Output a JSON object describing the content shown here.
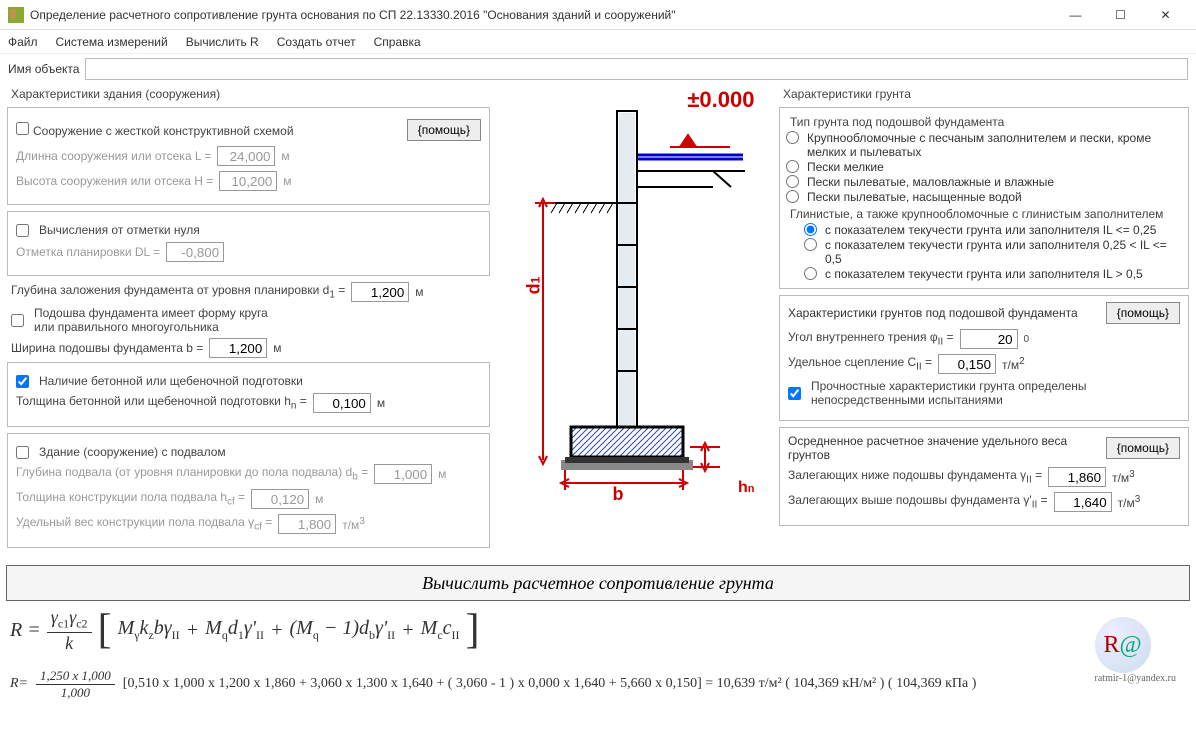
{
  "window": {
    "title": "Определение расчетного сопротивление грунта основания по СП 22.13330.2016  \"Основания зданий и сооружений\""
  },
  "menu": {
    "file": "Файл",
    "meas": "Система измерений",
    "calcR": "Вычислить R",
    "report": "Создать отчет",
    "help": "Справка"
  },
  "obj": {
    "label": "Имя объекта",
    "value": ""
  },
  "left": {
    "title": "Характеристики  здания (сооружения)",
    "help": "{помощь}",
    "rigid_check": "Сооружение с жесткой конструктивной схемой",
    "L_label": "Длинна сооружения или отсека L = ",
    "L_val": "24,000",
    "m": "м",
    "H_label": "Высота сооружения или отсека H = ",
    "H_val": "10,200",
    "zero_check": "Вычисления от отметки нуля",
    "DL_label": "Отметка планировки DL = ",
    "DL_val": "-0,800",
    "d1_label_a": "Глубина заложения фундамента от уровня планировки  d",
    "d1_sub": "1",
    "d1_eq": " =  ",
    "d1_val": "1,200",
    "circle_check1": "Подошва фундамента имеет форму круга",
    "circle_check2": "или правильного многоугольника",
    "b_label": "Ширина подошвы фундамента b = ",
    "b_val": "1,200",
    "prep_check": "Наличие бетонной или щебеночной подготовки",
    "hn_label_a": "Толщина бетонной или щебеночной подготовки  h",
    "hn_sub": "n",
    "hn_eq": " = ",
    "hn_val": "0,100",
    "basement_check": "Здание (сооружение) с подвалом",
    "db_label_a": "Глубина подвала (от уровня планировки до пола подвала) d",
    "db_sub": "b",
    "db_eq": " = ",
    "db_val": "1,000",
    "hcf_label_a": "Толщина конструкции пола подвала  h",
    "hcf_sub": "cf",
    "hcf_eq": " = ",
    "hcf_val": "0,120",
    "gcf_label_a": "Удельный вес конструкции пола подвала  γ",
    "gcf_sub": "cf",
    "gcf_eq": " = ",
    "gcf_val": "1,800",
    "tm3": "т/м",
    "sup3": "3"
  },
  "diagram": {
    "zero": "±0.000",
    "d1": "d1",
    "b": "b",
    "hn": "hn"
  },
  "right": {
    "title": "Характеристики грунта",
    "soil_title": "Тип грунта под подошвой фундамента",
    "opt1a": "Крупнообломочные с песчаным заполнителем и пески, кроме",
    "opt1b": "мелких и пылеватых",
    "opt2": "Пески мелкие",
    "opt3": "Пески пылеватые, маловлажные и влажные",
    "opt4": "Пески пылеватые, насыщенные водой",
    "clay_title": "Глинистые, а также крупнообломочные с глинистым заполнителем",
    "opt5": "с показателем текучести грунта или заполнителя IL <= 0,25",
    "opt6": "с показателем текучести грунта или заполнителя 0,25 < IL <= 0,5",
    "opt7": "с показателем текучести грунта или заполнителя IL > 0,5",
    "sec2_title": "Характеристики грунтов под подошвой фундамента",
    "help": "{помощь}",
    "phi_label_a": "Угол внутреннего трения   φ",
    "phi_sub": "II",
    "phi_eq": " = ",
    "phi_val": "20",
    "deg": "0",
    "c_label_a": "Удельное сцепление   C",
    "c_sub": "II",
    "c_eq": " = ",
    "c_val": "0,150",
    "tm2": "т/м",
    "sup2": "2",
    "strength_check1": "Прочностные характеристики грунта определены",
    "strength_check2": "непосредственными испытаниями",
    "sec3_title": "Осредненное расчетное значение удельного веса грунтов",
    "g2_label": "Залегающих ниже подошвы фундамента  γ",
    "g2_sub": "II",
    "g2_eq": " = ",
    "g2_val": "1,860",
    "g2p_label": "Залегающих выше подошвы фундамента  γ'",
    "g2p_sub": "II",
    "g2p_eq": " = ",
    "g2p_val": "1,640"
  },
  "calc_button": "Вычислить расчетное сопротивление грунта",
  "formula": {
    "Req": "R = ",
    "gc12": "γc1γc2",
    "k": "k",
    "t1a": "M",
    "t1s": "γ",
    "t1b": "k",
    "t1bs": "z",
    "t1c": "bγ",
    "t1cs": "II",
    "plus": " + ",
    "t2a": "M",
    "t2s": "q",
    "t2b": "d",
    "t2bs": "1",
    "t2c": "γ'",
    "t2cs": "II",
    "t3a": "(M",
    "t3s": "q",
    "t3b": " − 1)d",
    "t3bs": "b",
    "t3c": "γ'",
    "t3cs": "II",
    "t4a": "M",
    "t4s": "c",
    "t4b": "c",
    "t4bs": "II"
  },
  "result": {
    "Req": "R= ",
    "num": "1,250 x 1,000",
    "den": "1,000",
    "body": "[0,510 x 1,000 x 1,200 x 1,860 + 3,060 x 1,300 x 1,640 + ( 3,060 - 1 ) x 0,000 x 1,640 + 5,660 x 0,150] = 10,639 т/м² ( 104,369 кН/м² )  ( 104,369 кПа )"
  },
  "email": "ratmir-1@yandex.ru"
}
